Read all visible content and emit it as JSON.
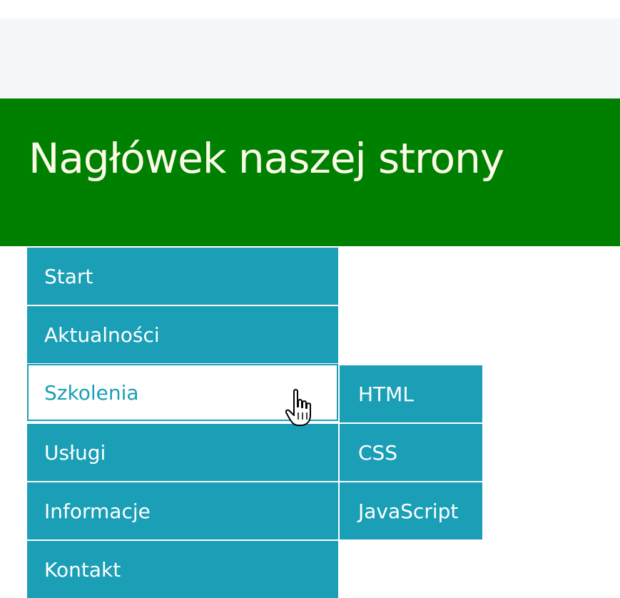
{
  "header": {
    "title": "Nagłówek naszej strony"
  },
  "menu": {
    "items": [
      {
        "label": "Start"
      },
      {
        "label": "Aktualności"
      },
      {
        "label": "Szkolenia"
      },
      {
        "label": "Usługi"
      },
      {
        "label": "Informacje"
      },
      {
        "label": "Kontakt"
      }
    ],
    "active_item": "Szkolenia",
    "submenu": [
      {
        "label": "HTML"
      },
      {
        "label": "CSS"
      },
      {
        "label": "JavaScript"
      }
    ]
  },
  "colors": {
    "header_bg": "#008000",
    "header_text": "#fcfce8",
    "menu_bg": "#1a9fb7",
    "menu_text": "#ffffff",
    "active_bg": "#ffffff"
  },
  "icons": {
    "cursor": "hand-pointer-icon"
  }
}
